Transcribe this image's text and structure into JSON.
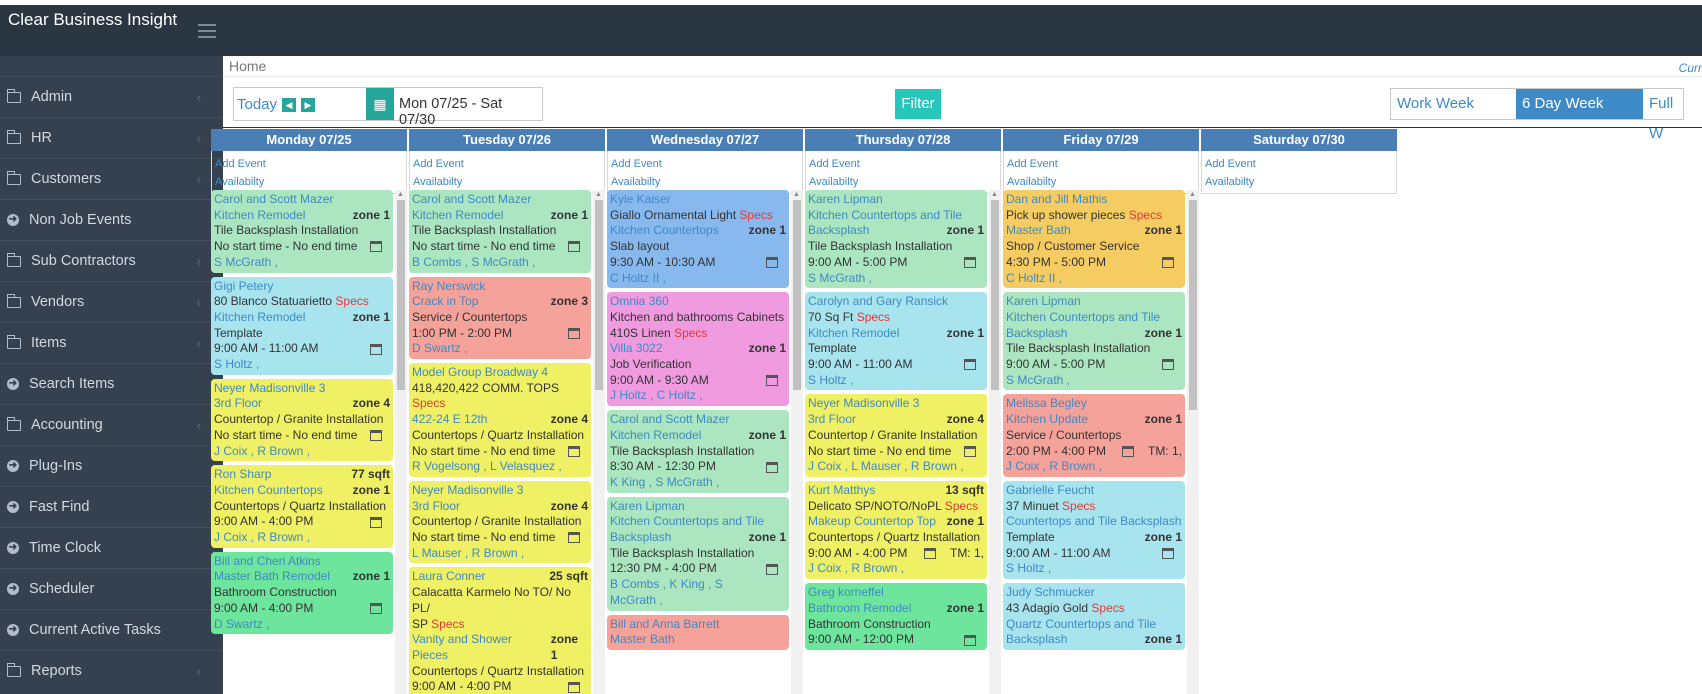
{
  "app": {
    "title": "Clear Business Insight"
  },
  "sidebar": {
    "items": [
      {
        "label": "Admin",
        "icon": "folder-icon",
        "chev": true
      },
      {
        "label": "HR",
        "icon": "folder-icon",
        "chev": true
      },
      {
        "label": "Customers",
        "icon": "folder-icon",
        "chev": true
      },
      {
        "label": "Non Job Events",
        "icon": "arrow-circle-icon",
        "chev": false
      },
      {
        "label": "Sub Contractors",
        "icon": "folder-icon",
        "chev": true
      },
      {
        "label": "Vendors",
        "icon": "folder-icon",
        "chev": true
      },
      {
        "label": "Items",
        "icon": "folder-icon",
        "chev": true
      },
      {
        "label": "Search Items",
        "icon": "arrow-circle-icon",
        "chev": false
      },
      {
        "label": "Accounting",
        "icon": "folder-icon",
        "chev": true
      },
      {
        "label": "Plug-Ins",
        "icon": "arrow-circle-icon",
        "chev": false
      },
      {
        "label": "Fast Find",
        "icon": "arrow-circle-icon",
        "chev": false
      },
      {
        "label": "Time Clock",
        "icon": "arrow-circle-icon",
        "chev": false
      },
      {
        "label": "Scheduler",
        "icon": "arrow-circle-icon",
        "chev": false
      },
      {
        "label": "Current Active Tasks",
        "icon": "arrow-circle-icon",
        "chev": false
      },
      {
        "label": "Reports",
        "icon": "folder-icon",
        "chev": true
      }
    ]
  },
  "header": {
    "breadcrumb": "Home",
    "cur": "Curr"
  },
  "toolbar": {
    "today": "Today",
    "range": "Mon 07/25 - Sat 07/30",
    "filter": "Filter",
    "views": [
      {
        "label": "Work Week",
        "active": false
      },
      {
        "label": "6 Day Week",
        "active": true
      },
      {
        "label": "Full W",
        "active": false
      }
    ]
  },
  "calendar": {
    "add_event": "Add Event",
    "availability": "Availabilty",
    "days": [
      {
        "label": "Monday 07/25",
        "events": [
          {
            "color": "g1",
            "lines": [
              {
                "t": "Carol and Scott Mazer",
                "c": "blue"
              },
              {
                "t": "Kitchen Remodel",
                "c": "blue",
                "right": "zone 1"
              },
              {
                "t": "Tile Backsplash Installation"
              },
              {
                "t": "No start time - No end time",
                "cal": true
              },
              {
                "t": "S McGrath ,",
                "c": "blue"
              }
            ]
          },
          {
            "color": "cy",
            "lines": [
              {
                "t": "Gigi Petery",
                "c": "blue"
              },
              {
                "t": "80 Blanco Statuarietto",
                "spec": "Specs"
              },
              {
                "t": "Kitchen Remodel",
                "c": "blue",
                "right": "zone 1"
              },
              {
                "t": "Template"
              },
              {
                "t": "9:00 AM - 11:00 AM",
                "cal": true
              },
              {
                "t": "S Holtz ,",
                "c": "blue"
              }
            ]
          },
          {
            "color": "yl",
            "lines": [
              {
                "t": "Neyer Madisonville 3",
                "c": "blue"
              },
              {
                "t": "3rd Floor",
                "c": "blue",
                "right": "zone 4"
              },
              {
                "t": "Countertop / Granite Installation"
              },
              {
                "t": "No start time - No end time",
                "cal": true
              },
              {
                "t": "J Coix , R Brown ,",
                "c": "blue"
              }
            ]
          },
          {
            "color": "yl",
            "lines": [
              {
                "t": "Ron Sharp",
                "c": "blue",
                "right": "77 sqft"
              },
              {
                "t": "Kitchen Countertops",
                "c": "blue",
                "right": "zone 1"
              },
              {
                "t": "Countertops / Quartz Installation"
              },
              {
                "t": "9:00 AM - 4:00 PM",
                "cal": true
              },
              {
                "t": "J Coix , R Brown ,",
                "c": "blue"
              }
            ]
          },
          {
            "color": "gr",
            "lines": [
              {
                "t": "Bill and Cheri Atkins",
                "c": "blue"
              },
              {
                "t": "Master Bath Remodel",
                "c": "blue",
                "right": "zone 1"
              },
              {
                "t": "Bathroom Construction"
              },
              {
                "t": "9:00 AM - 4:00 PM",
                "cal": true
              },
              {
                "t": "D Swartz ,",
                "c": "blue"
              }
            ]
          }
        ]
      },
      {
        "label": "Tuesday 07/26",
        "events": [
          {
            "color": "g1",
            "lines": [
              {
                "t": "Carol and Scott Mazer",
                "c": "blue"
              },
              {
                "t": "Kitchen Remodel",
                "c": "blue",
                "right": "zone 1"
              },
              {
                "t": "Tile Backsplash Installation"
              },
              {
                "t": "No start time - No end time",
                "cal": true
              },
              {
                "t": "B Combs , S McGrath ,",
                "c": "blue"
              }
            ]
          },
          {
            "color": "sal",
            "lines": [
              {
                "t": "Ray Nerswick",
                "c": "blue"
              },
              {
                "t": "Crack in Top",
                "c": "blue",
                "right": "zone 3"
              },
              {
                "t": "Service / Countertops"
              },
              {
                "t": "1:00 PM - 2:00 PM",
                "cal": true
              },
              {
                "t": "D Swartz ,",
                "c": "blue"
              }
            ]
          },
          {
            "color": "yl",
            "lines": [
              {
                "t": "Model Group Broadway 4",
                "c": "blue"
              },
              {
                "t": "418,420,422 COMM. TOPS",
                "spec": "Specs"
              },
              {
                "t": "422-24 E 12th",
                "c": "blue",
                "right": "zone 4"
              },
              {
                "t": "Countertops / Quartz Installation"
              },
              {
                "t": "No start time - No end time",
                "cal": true
              },
              {
                "t": "R Vogelsong , L Velasquez ,",
                "c": "blue"
              }
            ]
          },
          {
            "color": "yl",
            "lines": [
              {
                "t": "Neyer Madisonville 3",
                "c": "blue"
              },
              {
                "t": "3rd Floor",
                "c": "blue",
                "right": "zone 4"
              },
              {
                "t": "Countertop / Granite Installation"
              },
              {
                "t": "No start time - No end time",
                "cal": true
              },
              {
                "t": "L Mauser , R Brown ,",
                "c": "blue"
              }
            ]
          },
          {
            "color": "yl",
            "lines": [
              {
                "t": "Laura Conner",
                "c": "blue",
                "right": "25 sqft"
              },
              {
                "t": "Calacatta Karmelo No TO/ No PL/"
              },
              {
                "t": "SP",
                "spec": "Specs"
              },
              {
                "t": "Vanity and Shower Pieces",
                "c": "blue",
                "right": "zone 1"
              },
              {
                "t": "Countertops / Quartz Installation"
              },
              {
                "t": "9:00 AM - 4:00 PM",
                "cal": true
              }
            ]
          }
        ]
      },
      {
        "label": "Wednesday 07/27",
        "events": [
          {
            "color": "bl",
            "lines": [
              {
                "t": "Kyle Kaiser",
                "c": "blue"
              },
              {
                "t": "Giallo Ornamental Light",
                "spec": "Specs"
              },
              {
                "t": "Kitchen Countertops",
                "c": "blue",
                "right": "zone 1"
              },
              {
                "t": "Slab layout"
              },
              {
                "t": "9:30 AM - 10:30 AM",
                "cal": true
              },
              {
                "t": "C Holtz II ,",
                "c": "blue"
              }
            ]
          },
          {
            "color": "pk",
            "lines": [
              {
                "t": "Omnia 360",
                "c": "blue"
              },
              {
                "t": "Kitchen and bathrooms Cabinets"
              },
              {
                "t": "410S Linen",
                "spec": "Specs"
              },
              {
                "t": "Villa 3022",
                "c": "blue",
                "right": "zone 1"
              },
              {
                "t": "Job Verification"
              },
              {
                "t": "9:00 AM - 9:30 AM",
                "cal": true
              },
              {
                "t": "J Holtz , C Holtz ,",
                "c": "blue"
              }
            ]
          },
          {
            "color": "g1",
            "lines": [
              {
                "t": "Carol and Scott Mazer",
                "c": "blue"
              },
              {
                "t": "Kitchen Remodel",
                "c": "blue",
                "right": "zone 1"
              },
              {
                "t": "Tile Backsplash Installation"
              },
              {
                "t": "8:30 AM - 12:30 PM",
                "cal": true
              },
              {
                "t": "K King , S McGrath ,",
                "c": "blue"
              }
            ]
          },
          {
            "color": "g1",
            "lines": [
              {
                "t": "Karen Lipman",
                "c": "blue"
              },
              {
                "t": "Kitchen Countertops and Tile",
                "c": "blue"
              },
              {
                "t": "Backsplash",
                "c": "blue",
                "right": "zone 1"
              },
              {
                "t": "Tile Backsplash Installation"
              },
              {
                "t": "12:30 PM - 4:00 PM",
                "cal": true
              },
              {
                "t": "B Combs , K King , S",
                "c": "blue"
              },
              {
                "t": "McGrath ,",
                "c": "blue"
              }
            ]
          },
          {
            "color": "sal",
            "lines": [
              {
                "t": "Bill and Anna Barrett",
                "c": "blue"
              },
              {
                "t": "Master Bath",
                "c": "blue"
              }
            ]
          }
        ]
      },
      {
        "label": "Thursday 07/28",
        "events": [
          {
            "color": "g1",
            "lines": [
              {
                "t": "Karen Lipman",
                "c": "blue"
              },
              {
                "t": "Kitchen Countertops and Tile",
                "c": "blue"
              },
              {
                "t": "Backsplash",
                "c": "blue",
                "right": "zone 1"
              },
              {
                "t": "Tile Backsplash Installation"
              },
              {
                "t": "9:00 AM - 5:00 PM",
                "cal": true
              },
              {
                "t": "S McGrath ,",
                "c": "blue"
              }
            ]
          },
          {
            "color": "cy",
            "lines": [
              {
                "t": "Carolyn and Gary Ransick",
                "c": "blue"
              },
              {
                "t": "70 Sq Ft",
                "spec": "Specs"
              },
              {
                "t": "Kitchen Remodel",
                "c": "blue",
                "right": "zone 1"
              },
              {
                "t": "Template"
              },
              {
                "t": "9:00 AM - 11:00 AM",
                "cal": true
              },
              {
                "t": "S Holtz ,",
                "c": "blue"
              }
            ]
          },
          {
            "color": "yl",
            "lines": [
              {
                "t": "Neyer Madisonville 3",
                "c": "blue"
              },
              {
                "t": "3rd Floor",
                "c": "blue",
                "right": "zone 4"
              },
              {
                "t": "Countertop / Granite Installation"
              },
              {
                "t": "No start time - No end time",
                "cal": true
              },
              {
                "t": "J Coix , L Mauser , R Brown ,",
                "c": "blue"
              }
            ]
          },
          {
            "color": "yl",
            "lines": [
              {
                "t": "Kurt Matthys",
                "c": "blue",
                "right": "13 sqft"
              },
              {
                "t": "Delicato SP/NOTO/NoPL",
                "spec": "Specs"
              },
              {
                "t": "Makeup Countertop Top",
                "c": "blue",
                "right": "zone 1"
              },
              {
                "t": "Countertops / Quartz Installation"
              },
              {
                "t": "9:00 AM - 4:00 PM",
                "cal": true,
                "tm": "TM: 1,"
              },
              {
                "t": "J Coix , R Brown ,",
                "c": "blue"
              }
            ]
          },
          {
            "color": "gr",
            "lines": [
              {
                "t": "Greg korneffel",
                "c": "blue"
              },
              {
                "t": "Bathroom Remodel",
                "c": "blue",
                "right": "zone 1"
              },
              {
                "t": "Bathroom Construction"
              },
              {
                "t": "9:00 AM - 12:00 PM",
                "cal": true
              }
            ]
          }
        ]
      },
      {
        "label": "Friday 07/29",
        "events": [
          {
            "color": "or",
            "lines": [
              {
                "t": "Dan and Jill Mathis",
                "c": "blue"
              },
              {
                "t": "Pick up shower pieces",
                "spec": "Specs"
              },
              {
                "t": "Master Bath",
                "c": "blue",
                "right": "zone 1"
              },
              {
                "t": "Shop / Customer Service"
              },
              {
                "t": "4:30 PM - 5:00 PM",
                "cal": true
              },
              {
                "t": "C Holtz II ,",
                "c": "blue"
              }
            ]
          },
          {
            "color": "g1",
            "lines": [
              {
                "t": "Karen Lipman",
                "c": "blue"
              },
              {
                "t": "Kitchen Countertops and Tile",
                "c": "blue"
              },
              {
                "t": "Backsplash",
                "c": "blue",
                "right": "zone 1"
              },
              {
                "t": "Tile Backsplash Installation"
              },
              {
                "t": "9:00 AM - 5:00 PM",
                "cal": true
              },
              {
                "t": "S McGrath ,",
                "c": "blue"
              }
            ]
          },
          {
            "color": "sal",
            "lines": [
              {
                "t": "Melissa Begley",
                "c": "blue"
              },
              {
                "t": "Kitchen Update",
                "c": "blue",
                "right": "zone 1"
              },
              {
                "t": "Service / Countertops"
              },
              {
                "t": "2:00 PM - 4:00 PM",
                "cal": true,
                "tm": "TM: 1,"
              },
              {
                "t": "J Coix , R Brown ,",
                "c": "blue"
              }
            ]
          },
          {
            "color": "cy",
            "lines": [
              {
                "t": "Gabrielle Feucht",
                "c": "blue"
              },
              {
                "t": "37 Minuet",
                "spec": "Specs"
              },
              {
                "t": "Countertops and Tile Backsplash",
                "c": "blue"
              },
              {
                "t": "Template",
                "right": "zone 1"
              },
              {
                "t": "9:00 AM - 11:00 AM",
                "cal": true
              },
              {
                "t": "S Holtz ,",
                "c": "blue"
              }
            ]
          },
          {
            "color": "cy",
            "lines": [
              {
                "t": "Judy Schmucker",
                "c": "blue"
              },
              {
                "t": "43 Adagio Gold",
                "spec": "Specs"
              },
              {
                "t": "Quartz Countertops and Tile",
                "c": "blue"
              },
              {
                "t": "Backsplash",
                "c": "blue",
                "right": "zone 1"
              }
            ]
          }
        ]
      },
      {
        "label": "Saturday 07/30",
        "events": []
      }
    ]
  }
}
